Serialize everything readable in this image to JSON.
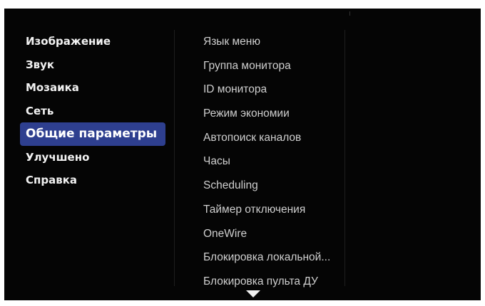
{
  "left_menu": {
    "items": [
      {
        "label": "Изображение"
      },
      {
        "label": "Звук"
      },
      {
        "label": "Мозаика"
      },
      {
        "label": "Сеть"
      },
      {
        "label": "Общие параметры",
        "selected": true
      },
      {
        "label": "Улучшено"
      },
      {
        "label": "Справка"
      }
    ]
  },
  "right_menu": {
    "items": [
      {
        "label": "Язык меню"
      },
      {
        "label": "Группа монитора"
      },
      {
        "label": "ID монитора"
      },
      {
        "label": "Режим экономии"
      },
      {
        "label": "Автопоиск каналов"
      },
      {
        "label": "Часы"
      },
      {
        "label": "Scheduling"
      },
      {
        "label": "Таймер отключения"
      },
      {
        "label": "OneWire"
      },
      {
        "label": "Блокировка локальной..."
      },
      {
        "label": "Блокировка пульта ДУ"
      }
    ]
  },
  "scroll": {
    "icon": "chevron-down-icon"
  },
  "colors": {
    "background": "#050505",
    "selected": "#2e3f8f",
    "left_text": "#f2f2f2",
    "right_text": "#cfcfcf"
  }
}
